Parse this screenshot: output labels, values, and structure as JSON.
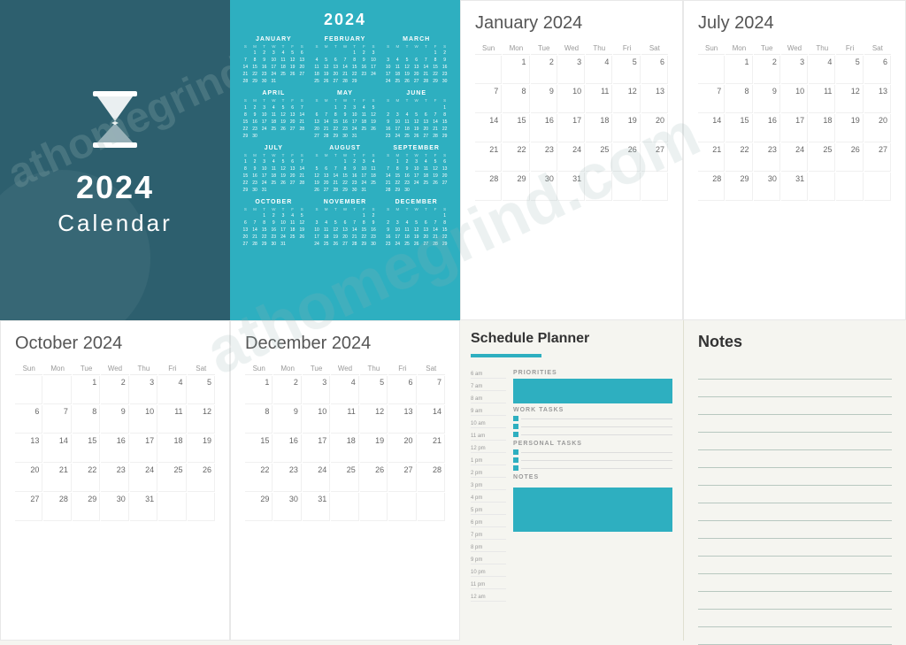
{
  "cover": {
    "year": "2024",
    "title": "Calendar",
    "background": "#2d5f6e"
  },
  "year_overview": {
    "title": "2024",
    "months": [
      {
        "name": "JANUARY",
        "days": [
          "",
          "1",
          "2",
          "3",
          "4",
          "5",
          "6",
          "7",
          "8",
          "9",
          "10",
          "11",
          "12",
          "13",
          "14",
          "15",
          "16",
          "17",
          "18",
          "19",
          "20",
          "21",
          "22",
          "23",
          "24",
          "25",
          "26",
          "27",
          "28",
          "29",
          "30",
          "31",
          "",
          "",
          "",
          "",
          ""
        ]
      },
      {
        "name": "FEBRUARY",
        "days": [
          "",
          "",
          "",
          "",
          "1",
          "2",
          "3",
          "4",
          "5",
          "6",
          "7",
          "8",
          "9",
          "10",
          "11",
          "12",
          "13",
          "14",
          "15",
          "16",
          "17",
          "18",
          "19",
          "20",
          "21",
          "22",
          "23",
          "24",
          "25",
          "26",
          "27",
          "28",
          "29",
          "",
          "",
          "",
          ""
        ]
      },
      {
        "name": "MARCH",
        "days": [
          "",
          "",
          "",
          "",
          "",
          "1",
          "2",
          "3",
          "4",
          "5",
          "6",
          "7",
          "8",
          "9",
          "10",
          "11",
          "12",
          "13",
          "14",
          "15",
          "16",
          "17",
          "18",
          "19",
          "20",
          "21",
          "22",
          "23",
          "24",
          "25",
          "26",
          "27",
          "28",
          "29",
          "30",
          "31"
        ]
      },
      {
        "name": "APRIL",
        "days": [
          "1",
          "2",
          "3",
          "4",
          "5",
          "6",
          "7",
          "8",
          "9",
          "10",
          "11",
          "12",
          "13",
          "14",
          "15",
          "16",
          "17",
          "18",
          "19",
          "20",
          "21",
          "22",
          "23",
          "24",
          "25",
          "26",
          "27",
          "28",
          "29",
          "30",
          "",
          "",
          "",
          "",
          "",
          ""
        ]
      },
      {
        "name": "MAY",
        "days": [
          "",
          "",
          "1",
          "2",
          "3",
          "4",
          "5",
          "6",
          "7",
          "8",
          "9",
          "10",
          "11",
          "12",
          "13",
          "14",
          "15",
          "16",
          "17",
          "18",
          "19",
          "20",
          "21",
          "22",
          "23",
          "24",
          "25",
          "26",
          "27",
          "28",
          "29",
          "30",
          "31",
          "",
          "",
          ""
        ]
      },
      {
        "name": "JUNE",
        "days": [
          "",
          "",
          "",
          "",
          "",
          "",
          "1",
          "2",
          "3",
          "4",
          "5",
          "6",
          "7",
          "8",
          "9",
          "10",
          "11",
          "12",
          "13",
          "14",
          "15",
          "16",
          "17",
          "18",
          "19",
          "20",
          "21",
          "22",
          "23",
          "24",
          "25",
          "26",
          "27",
          "28",
          "29",
          "30"
        ]
      },
      {
        "name": "JULY",
        "days": [
          "1",
          "2",
          "3",
          "4",
          "5",
          "6",
          "7",
          "8",
          "9",
          "10",
          "11",
          "12",
          "13",
          "14",
          "15",
          "16",
          "17",
          "18",
          "19",
          "20",
          "21",
          "22",
          "23",
          "24",
          "25",
          "26",
          "27",
          "28",
          "29",
          "30",
          "31",
          "",
          "",
          "",
          "",
          ""
        ]
      },
      {
        "name": "AUGUST",
        "days": [
          "",
          "",
          "",
          "1",
          "2",
          "3",
          "4",
          "5",
          "6",
          "7",
          "8",
          "9",
          "10",
          "11",
          "12",
          "13",
          "14",
          "15",
          "16",
          "17",
          "18",
          "19",
          "20",
          "21",
          "22",
          "23",
          "24",
          "25",
          "26",
          "27",
          "28",
          "29",
          "30",
          "31",
          "",
          ""
        ]
      },
      {
        "name": "SEPTEMBER",
        "days": [
          "",
          "1",
          "2",
          "3",
          "4",
          "5",
          "6",
          "7",
          "8",
          "9",
          "10",
          "11",
          "12",
          "13",
          "14",
          "15",
          "16",
          "17",
          "18",
          "19",
          "20",
          "21",
          "22",
          "23",
          "24",
          "25",
          "26",
          "27",
          "28",
          "29",
          "30",
          "",
          "",
          "",
          "",
          ""
        ]
      },
      {
        "name": "OCTOBER",
        "days": [
          "",
          "",
          "1",
          "2",
          "3",
          "4",
          "5",
          "6",
          "7",
          "8",
          "9",
          "10",
          "11",
          "12",
          "13",
          "14",
          "15",
          "16",
          "17",
          "18",
          "19",
          "20",
          "21",
          "22",
          "23",
          "24",
          "25",
          "26",
          "27",
          "28",
          "29",
          "30",
          "31",
          "",
          "",
          ""
        ]
      },
      {
        "name": "NOVEMBER",
        "days": [
          "",
          "",
          "",
          "",
          "",
          "1",
          "2",
          "3",
          "4",
          "5",
          "6",
          "7",
          "8",
          "9",
          "10",
          "11",
          "12",
          "13",
          "14",
          "15",
          "16",
          "17",
          "18",
          "19",
          "20",
          "21",
          "22",
          "23",
          "24",
          "25",
          "26",
          "27",
          "28",
          "29",
          "30",
          ""
        ]
      },
      {
        "name": "DECEMBER",
        "days": [
          "",
          "",
          "",
          "",
          "",
          "",
          "1",
          "2",
          "3",
          "4",
          "5",
          "6",
          "7",
          "8",
          "9",
          "10",
          "11",
          "12",
          "13",
          "14",
          "15",
          "16",
          "17",
          "18",
          "19",
          "20",
          "21",
          "22",
          "23",
          "24",
          "25",
          "26",
          "27",
          "28",
          "29",
          "30",
          "31"
        ]
      }
    ]
  },
  "january": {
    "title": "January 2024",
    "headers": [
      "Sun",
      "Mon",
      "Tue",
      "Wed",
      "Thu",
      "Fri",
      "Sat"
    ],
    "weeks": [
      [
        "",
        "1",
        "2",
        "3",
        "4",
        "5",
        "6"
      ],
      [
        "7",
        "8",
        "9",
        "10",
        "11",
        "12",
        "13"
      ],
      [
        "14",
        "15",
        "16",
        "17",
        "18",
        "19",
        "20"
      ],
      [
        "21",
        "22",
        "23",
        "24",
        "25",
        "26",
        "27"
      ],
      [
        "28",
        "29",
        "30",
        "31",
        "",
        "",
        ""
      ]
    ]
  },
  "july": {
    "title": "July 2024",
    "headers": [
      "Sun",
      "Mon",
      "Tue",
      "Wed",
      "Thu",
      "Fri",
      "Sat"
    ],
    "weeks": [
      [
        "",
        "1",
        "2",
        "3",
        "4",
        "5",
        "6"
      ],
      [
        "7",
        "8",
        "9",
        "10",
        "11",
        "12",
        "13"
      ],
      [
        "14",
        "15",
        "16",
        "17",
        "18",
        "19",
        "20"
      ],
      [
        "21",
        "22",
        "23",
        "24",
        "25",
        "26",
        "27"
      ],
      [
        "28",
        "29",
        "30",
        "31",
        "",
        "",
        ""
      ]
    ]
  },
  "october": {
    "title": "October 2024",
    "headers": [
      "Sun",
      "Mon",
      "Tue",
      "Wed",
      "Thu",
      "Fri",
      "Sat"
    ],
    "weeks": [
      [
        "",
        "",
        "1",
        "2",
        "3",
        "4",
        "5"
      ],
      [
        "6",
        "7",
        "8",
        "9",
        "10",
        "11",
        "12"
      ],
      [
        "13",
        "14",
        "15",
        "16",
        "17",
        "18",
        "19"
      ],
      [
        "20",
        "21",
        "22",
        "23",
        "24",
        "25",
        "26"
      ],
      [
        "27",
        "28",
        "29",
        "30",
        "31",
        "",
        ""
      ]
    ]
  },
  "december": {
    "title": "December 2024",
    "headers": [
      "Sun",
      "Mon",
      "Tue",
      "Wed",
      "Thu",
      "Fri",
      "Sat"
    ],
    "weeks": [
      [
        "1",
        "2",
        "3",
        "4",
        "5",
        "6",
        "7"
      ],
      [
        "8",
        "9",
        "10",
        "11",
        "12",
        "13",
        "14"
      ],
      [
        "15",
        "16",
        "17",
        "18",
        "19",
        "20",
        "21"
      ],
      [
        "22",
        "23",
        "24",
        "25",
        "26",
        "27",
        "28"
      ],
      [
        "29",
        "30",
        "31",
        "",
        "",
        "",
        ""
      ]
    ]
  },
  "schedule": {
    "title": "Schedule Planner",
    "priorities_label": "PRIORITIES",
    "work_tasks_label": "WORK TASKS",
    "personal_tasks_label": "PERSONAL TASKS",
    "notes_label": "NOTES",
    "time_slots": [
      "6 am",
      "7 am",
      "8 am",
      "9 am",
      "10 am",
      "11 am",
      "12 pm",
      "1 pm",
      "2 pm",
      "3 pm",
      "4 pm",
      "5 pm",
      "6 pm",
      "7 pm",
      "8 pm",
      "9 pm",
      "10 pm",
      "11 pm",
      "12 am"
    ]
  },
  "notes": {
    "title": "Notes",
    "line_count": 16
  },
  "watermark": {
    "text": "athomegrind.com"
  },
  "colors": {
    "teal": "#2eafc0",
    "dark_teal": "#2d5f6e",
    "light_bg": "#f5f5f0",
    "text_dark": "#333333",
    "text_medium": "#666666",
    "text_light": "#999999"
  }
}
